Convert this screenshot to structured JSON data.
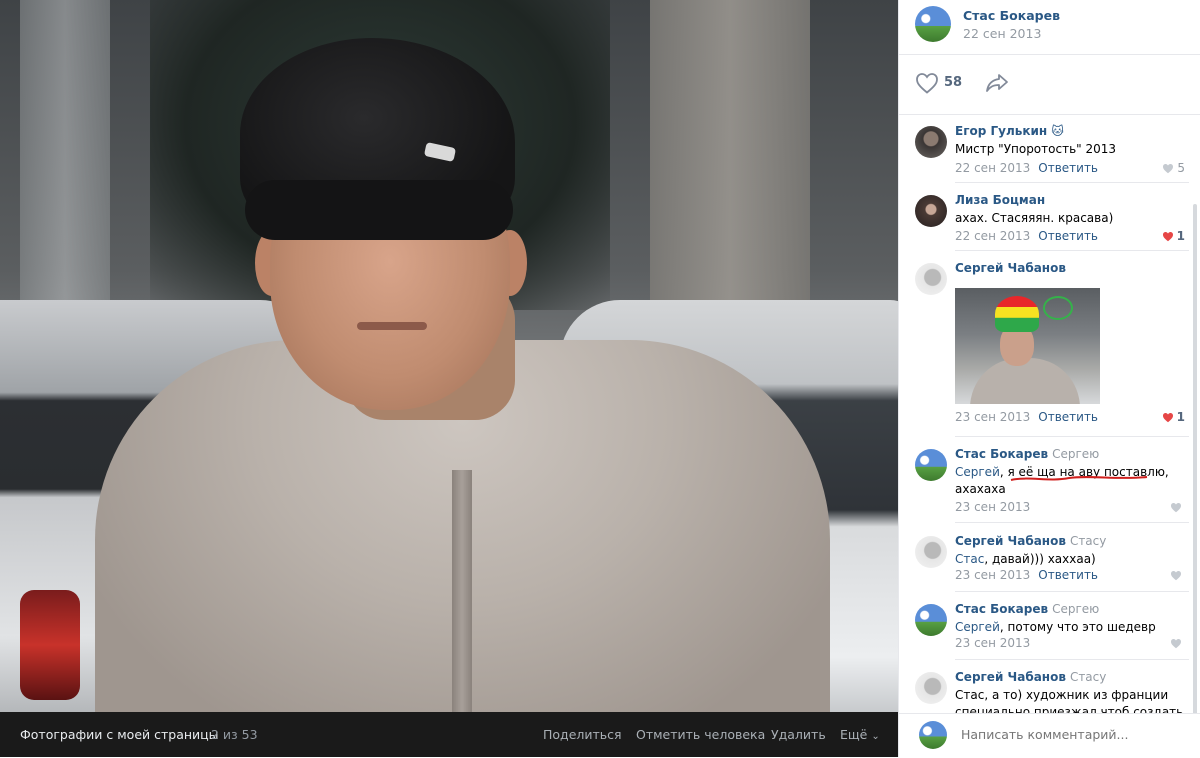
{
  "photo_panel": {
    "album_title": "Фотографии с моей страницы",
    "counter": "2 из 53",
    "actions": {
      "share": "Поделиться",
      "tag": "Отметить человека",
      "delete": "Удалить",
      "more": "Ещё"
    }
  },
  "post": {
    "author": "Стас Бокарев",
    "date": "22 сен 2013",
    "likes": "58"
  },
  "comments": [
    {
      "author": "Егор Гулькин",
      "reply_to": "",
      "text": "Мистр \"Упоротость\" 2013",
      "mention": "",
      "date": "22 сен 2013",
      "reply_label": "Ответить",
      "likes": "5",
      "liked": false
    },
    {
      "author": "Лиза Боцман",
      "reply_to": "",
      "text": "ахах. Стасяяян. красава)",
      "mention": "",
      "date": "22 сен 2013",
      "reply_label": "Ответить",
      "likes": "1",
      "liked": true
    },
    {
      "author": "Сергей Чабанов",
      "reply_to": "",
      "text": "",
      "mention": "",
      "date": "23 сен 2013",
      "reply_label": "Ответить",
      "likes": "1",
      "liked": true
    },
    {
      "author": "Стас Бокарев",
      "reply_to": "Сергею",
      "mention": "Сергей",
      "text": ", я её ща на аву поставлю, ахахаха",
      "date": "23 сен 2013",
      "reply_label": "",
      "likes": "",
      "liked": false
    },
    {
      "author": "Сергей Чабанов",
      "reply_to": "Стасу",
      "mention": "Стас",
      "text": ", давай))) хаххаа)",
      "date": "23 сен 2013",
      "reply_label": "Ответить",
      "likes": "",
      "liked": false
    },
    {
      "author": "Стас Бокарев",
      "reply_to": "Сергею",
      "mention": "Сергей",
      "text": ", потому что это шедевр",
      "date": "23 сен 2013",
      "reply_label": "",
      "likes": "",
      "liked": false
    },
    {
      "author": "Сергей Чабанов",
      "reply_to": "Стасу",
      "mention": "",
      "text": "Стас, а то) художник из франции специально приезжал чтоб создать",
      "date": "",
      "reply_label": "",
      "likes": "",
      "liked": false
    }
  ],
  "composer": {
    "placeholder": "Написать комментарий..."
  },
  "colors": {
    "link": "#2a5885",
    "muted": "#939aa2",
    "like_red": "#e64646",
    "bar_bg": "#1a1a1a"
  }
}
